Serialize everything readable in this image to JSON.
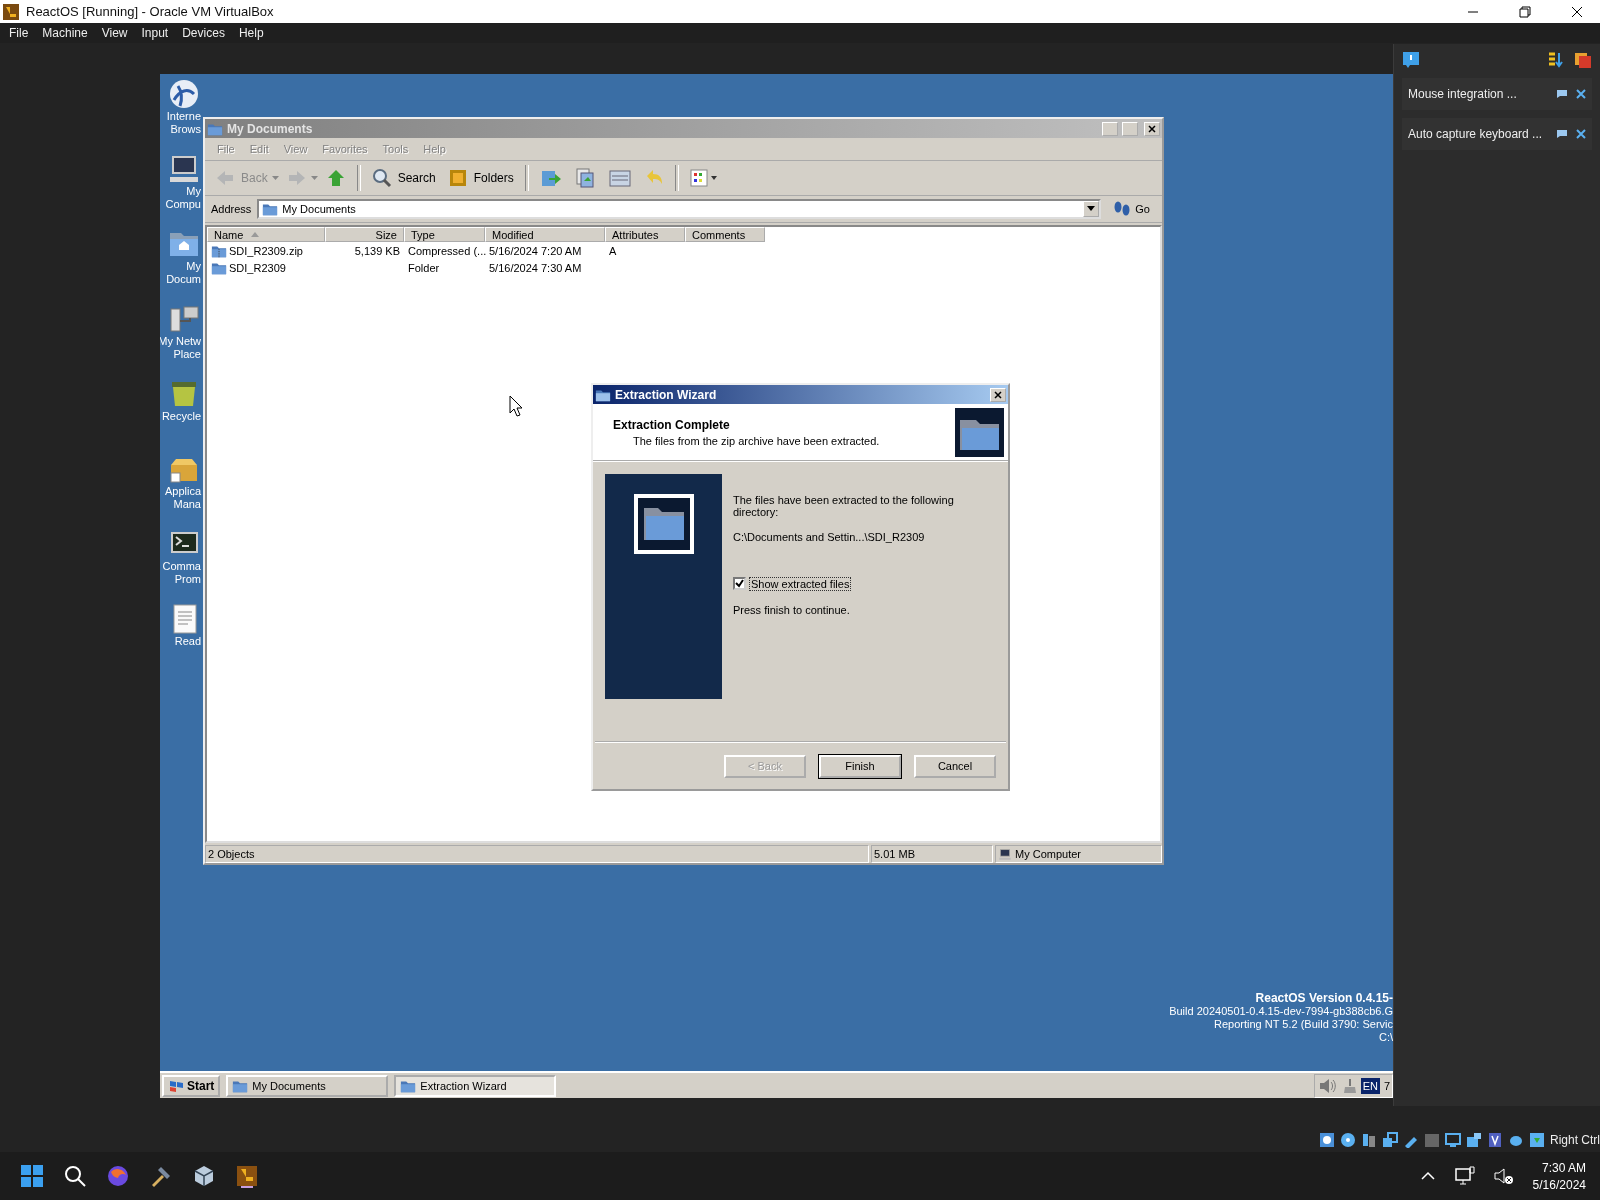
{
  "host_window": {
    "title": "ReactOS [Running] - Oracle VM VirtualBox"
  },
  "host_menu": [
    "File",
    "Machine",
    "View",
    "Input",
    "Devices",
    "Help"
  ],
  "desktop_icons": [
    {
      "kind": "globe",
      "lines": [
        "Interne",
        "Brows"
      ]
    },
    {
      "kind": "computer",
      "lines": [
        "My",
        "Compu"
      ]
    },
    {
      "kind": "documents",
      "lines": [
        "My",
        "Docum"
      ]
    },
    {
      "kind": "network",
      "lines": [
        "My Netw",
        "Place"
      ]
    },
    {
      "kind": "recycle",
      "lines": [
        "Recycle"
      ]
    },
    {
      "kind": "package",
      "lines": [
        "Applica",
        "Mana"
      ]
    },
    {
      "kind": "console",
      "lines": [
        "Comma",
        "Prom"
      ]
    },
    {
      "kind": "text",
      "lines": [
        "Read"
      ]
    }
  ],
  "explorer": {
    "title": "My Documents",
    "menu": [
      "File",
      "Edit",
      "View",
      "Favorites",
      "Tools",
      "Help"
    ],
    "toolbar": [
      {
        "kind": "back",
        "label": "Back",
        "disabled": true
      },
      {
        "kind": "forward",
        "disabled": true
      },
      {
        "kind": "up",
        "disabled": false
      },
      {
        "kind": "search",
        "label": "Search",
        "disabled": false
      },
      {
        "kind": "folders",
        "label": "Folders",
        "disabled": false
      },
      {
        "kind": "move",
        "disabled": false
      },
      {
        "kind": "copy",
        "disabled": false
      },
      {
        "kind": "delete",
        "disabled": false
      },
      {
        "kind": "undo",
        "disabled": false
      },
      {
        "kind": "views",
        "disabled": false
      }
    ],
    "address": {
      "label": "Address",
      "value": "My Documents",
      "go": "Go"
    },
    "columns": [
      {
        "label": "Name",
        "sorted": true
      },
      {
        "label": "Size",
        "sorted": false
      },
      {
        "label": "Type",
        "sorted": false
      },
      {
        "label": "Modified",
        "sorted": false
      },
      {
        "label": "Attributes",
        "sorted": false
      },
      {
        "label": "Comments",
        "sorted": false
      }
    ],
    "rows": [
      {
        "kind": "zip",
        "name": "SDI_R2309.zip",
        "size": "5,139 KB",
        "type": "Compressed (...",
        "modified": "5/16/2024 7:20 AM",
        "attributes": "A"
      },
      {
        "kind": "folder",
        "name": "SDI_R2309",
        "type": "Folder",
        "modified": "5/16/2024 7:30 AM"
      }
    ],
    "status_bar": [
      "2 Objects",
      "5.01 MB",
      "My Computer"
    ]
  },
  "dialog": {
    "title": "Extraction Wizard",
    "heading": "Extraction Complete",
    "subheading": "The files from the zip archive have been extracted.",
    "message": "The files have been extracted to the following directory:",
    "path": "C:\\Documents and Settin...\\SDI_R2309",
    "checkbox": {
      "label": "Show extracted files",
      "checked": true
    },
    "note": "Press finish to continue.",
    "buttons": [
      {
        "label": "< Back",
        "disabled": true,
        "default": false
      },
      {
        "label": "Finish",
        "disabled": false,
        "default": true
      },
      {
        "label": "Cancel",
        "disabled": false,
        "default": false
      }
    ]
  },
  "version_text": [
    "ReactOS Version 0.4.15-",
    "Build 20240501-0.4.15-dev-7994-gb388cb6.G",
    "Reporting NT 5.2 (Build 3790: Servic",
    "C:\\"
  ],
  "guest_taskbar": {
    "start": "Start",
    "tasks": [
      {
        "label": "My Documents",
        "selected": false
      },
      {
        "label": "Extraction Wizard",
        "selected": true
      }
    ],
    "language": "EN",
    "clock": "7"
  },
  "notifications": [
    "Mouse integration ...",
    "Auto capture keyboard ..."
  ],
  "host_status": {
    "key": "Right Ctrl"
  },
  "host_taskbar": {
    "time": "7:30 AM",
    "date": "5/16/2024"
  }
}
